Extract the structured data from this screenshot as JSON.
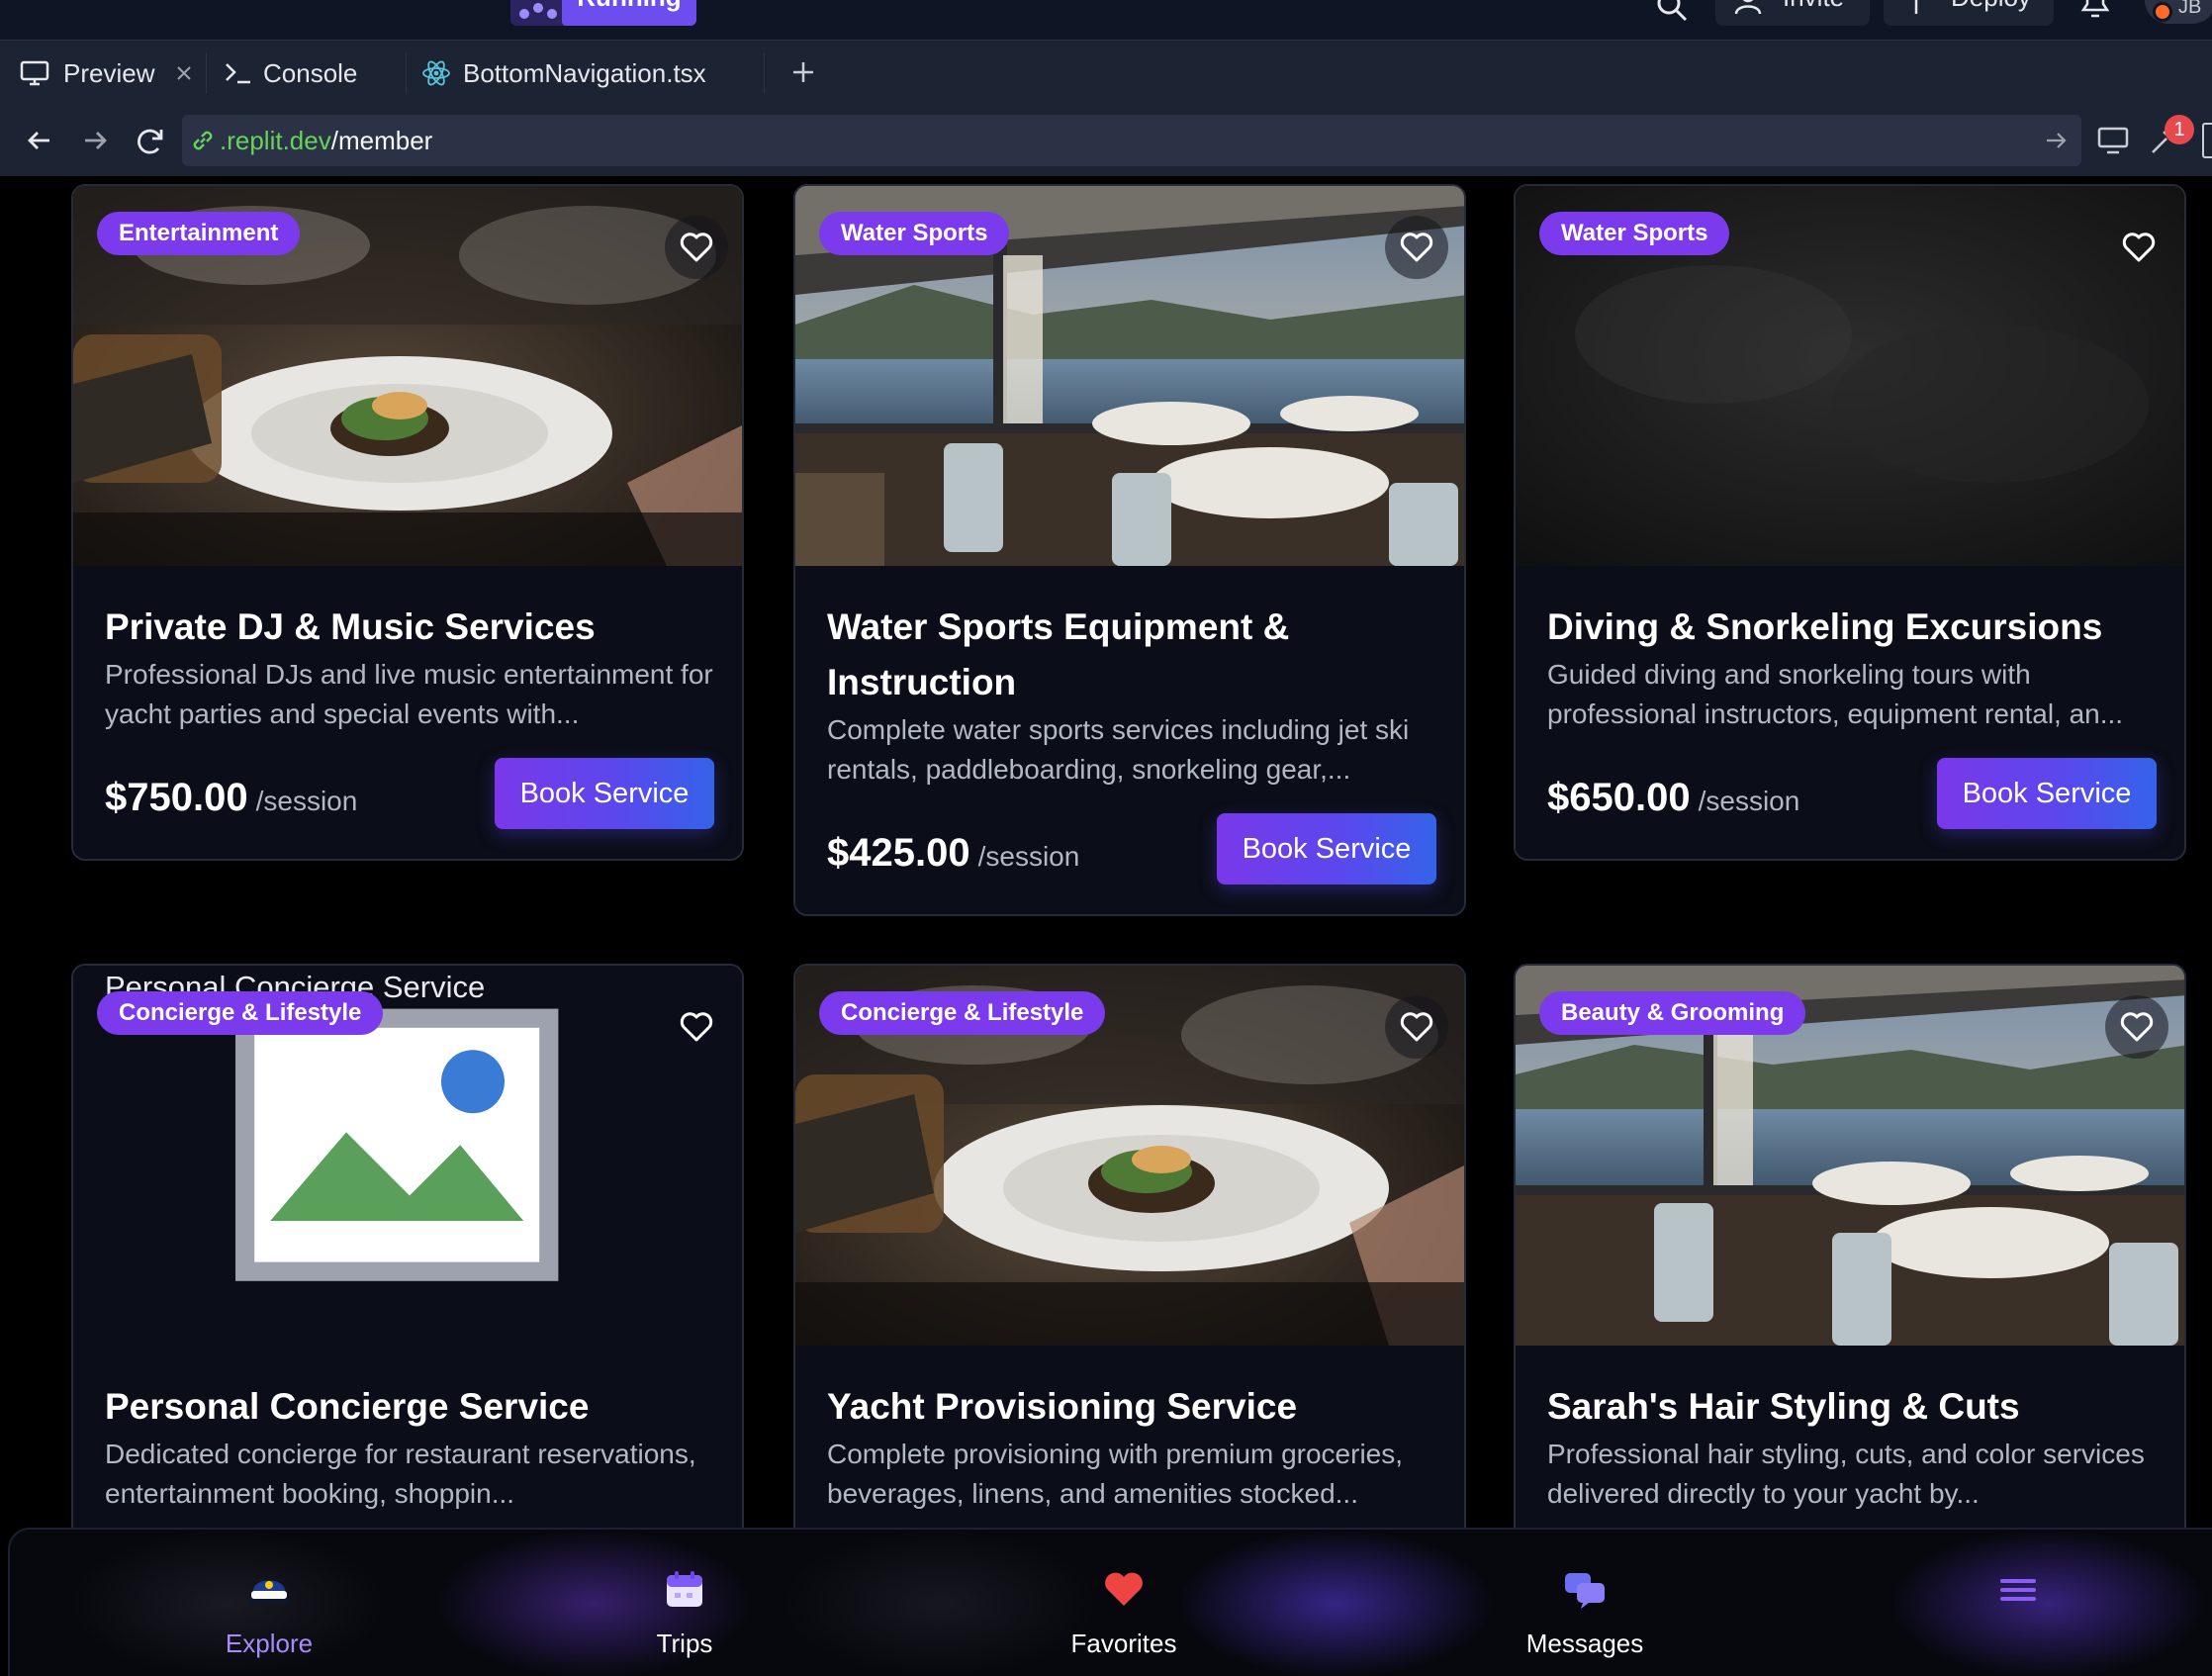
{
  "topbar": {
    "run_label": "Running",
    "invite_label": "Invite",
    "deploy_label": "Deploy",
    "avatar_initials": "JB"
  },
  "tabs": [
    {
      "label": "Preview",
      "icon": "monitor-icon"
    },
    {
      "label": "Console",
      "icon": "terminal-icon"
    },
    {
      "label": "BottomNavigation.tsx",
      "icon": "react-icon"
    }
  ],
  "urlbar": {
    "host": ".replit.dev",
    "path": "/member",
    "notification_count": "1"
  },
  "cards": [
    {
      "category": "Entertainment",
      "title": "Private DJ & Music Services",
      "description": "Professional DJs and live music entertainment for yacht parties and special events with...",
      "price": "$750.00",
      "unit": "/session",
      "button": "Book Service"
    },
    {
      "category": "Water Sports",
      "title": "Water Sports Equipment & Instruction",
      "description": "Complete water sports services including jet ski rentals, paddleboarding, snorkeling gear,...",
      "price": "$425.00",
      "unit": "/session",
      "button": "Book Service"
    },
    {
      "category": "Water Sports",
      "title": "Diving & Snorkeling Excursions",
      "description": "Guided diving and snorkeling tours with professional instructors, equipment rental, an...",
      "price": "$650.00",
      "unit": "/session",
      "button": "Book Service"
    },
    {
      "category": "Concierge & Lifestyle",
      "title": "Personal Concierge Service",
      "description": "Dedicated concierge for restaurant reservations, entertainment booking, shoppin...",
      "image_alt": "Personal Concierge Service"
    },
    {
      "category": "Concierge & Lifestyle",
      "title": "Yacht Provisioning Service",
      "description": "Complete provisioning with premium groceries, beverages, linens, and amenities stocked..."
    },
    {
      "category": "Beauty & Grooming",
      "title": "Sarah's Hair Styling & Cuts",
      "description": "Professional hair styling, cuts, and color services delivered directly to your yacht by..."
    }
  ],
  "bottom_nav": [
    {
      "label": "Explore",
      "icon": "captain-hat-icon",
      "active": true
    },
    {
      "label": "Trips",
      "icon": "calendar-icon"
    },
    {
      "label": "Favorites",
      "icon": "heart-icon"
    },
    {
      "label": "Messages",
      "icon": "chat-bubbles-icon"
    },
    {
      "label": "",
      "icon": "menu-icon"
    }
  ],
  "colors": {
    "accent_purple": "#7c3aed",
    "button_gradient_start": "#7a38ea",
    "button_gradient_end": "#3563ea",
    "active_nav": "#a78bfa",
    "url_host_green": "#67d35b"
  }
}
